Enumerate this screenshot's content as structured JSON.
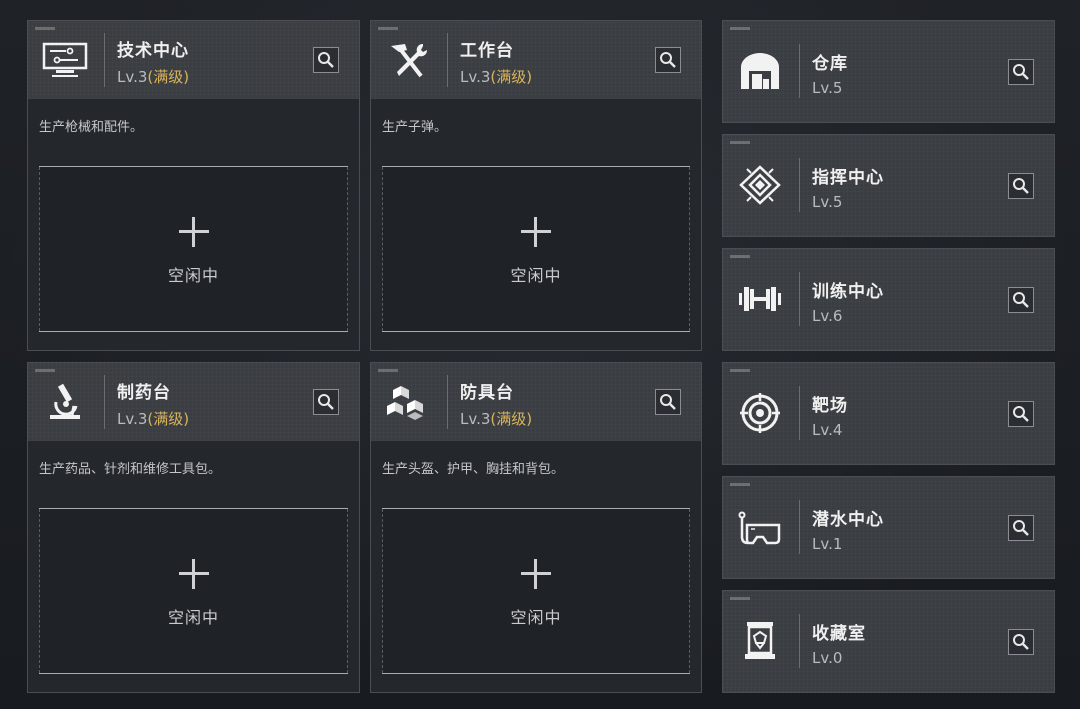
{
  "big_cards": [
    {
      "title": "技术中心",
      "level": "Lv.3",
      "max": "(满级)",
      "desc": "生产枪械和配件。",
      "plus": "+",
      "idle": "空闲中"
    },
    {
      "title": "工作台",
      "level": "Lv.3",
      "max": "(满级)",
      "desc": "生产子弹。",
      "plus": "+",
      "idle": "空闲中"
    },
    {
      "title": "制药台",
      "level": "Lv.3",
      "max": "(满级)",
      "desc": "生产药品、针剂和维修工具包。",
      "plus": "+",
      "idle": "空闲中"
    },
    {
      "title": "防具台",
      "level": "Lv.3",
      "max": "(满级)",
      "desc": "生产头盔、护甲、胸挂和背包。",
      "plus": "+",
      "idle": "空闲中"
    }
  ],
  "small_cards": [
    {
      "title": "仓库",
      "level": "Lv.5"
    },
    {
      "title": "指挥中心",
      "level": "Lv.5"
    },
    {
      "title": "训练中心",
      "level": "Lv.6"
    },
    {
      "title": "靶场",
      "level": "Lv.4"
    },
    {
      "title": "潜水中心",
      "level": "Lv.1"
    },
    {
      "title": "收藏室",
      "level": "Lv.0"
    }
  ],
  "icons": {
    "big": [
      "computer-icon",
      "tools-icon",
      "microscope-icon",
      "cubes-icon"
    ],
    "small": [
      "warehouse-icon",
      "command-emblem-icon",
      "dumbbell-icon",
      "target-icon",
      "diving-mask-icon",
      "display-case-icon"
    ]
  },
  "colors": {
    "max_level": "#d9b45a",
    "card_bg": "#24272b",
    "card_head": "#3a3d41"
  }
}
